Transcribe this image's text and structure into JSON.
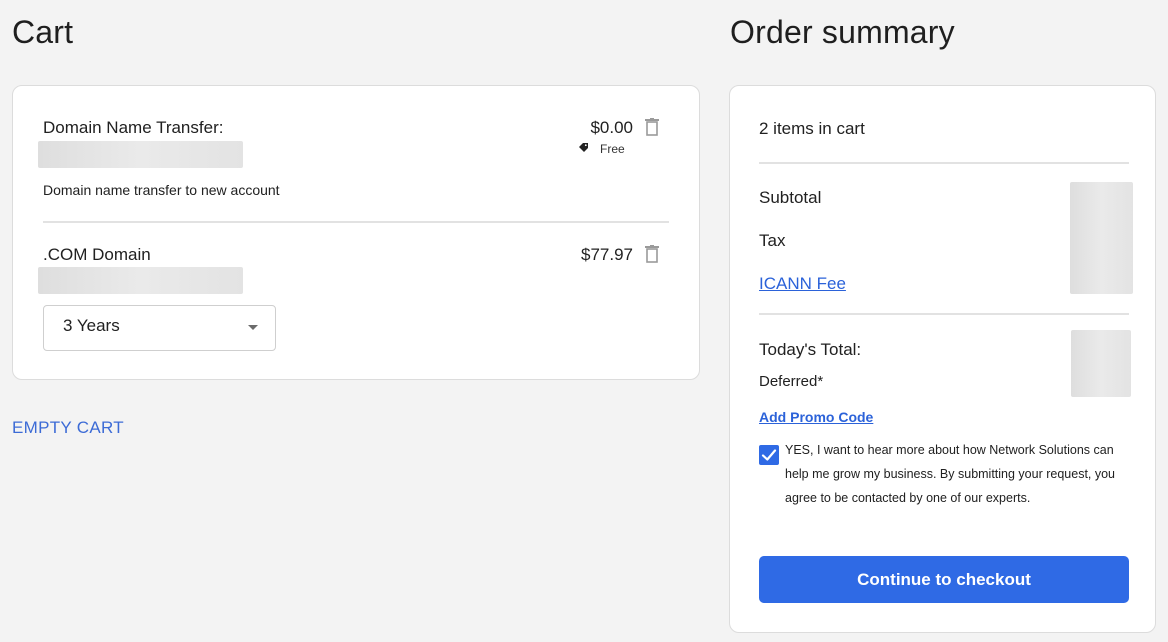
{
  "cart": {
    "title": "Cart",
    "items": [
      {
        "name": "Domain Name Transfer:",
        "price": "$0.00",
        "badge_icon": "tag-icon",
        "badge": "Free",
        "description": "Domain name transfer to new account"
      },
      {
        "name": ".COM Domain",
        "price": "$77.97",
        "term_selected": "3 Years"
      }
    ],
    "empty_cart_label": "EMPTY CART"
  },
  "summary": {
    "title": "Order summary",
    "items_count": "2 items in cart",
    "subtotal_label": "Subtotal",
    "tax_label": "Tax",
    "icann_label": "ICANN Fee",
    "total_label": "Today's Total:",
    "deferred_label": "Deferred*",
    "promo_label": "Add Promo Code",
    "consent_checked": true,
    "consent_text": "YES, I want to hear more about how Network Solutions can help me grow my business. By submitting your request, you agree to be contacted by one of our experts.",
    "checkout_label": "Continue to checkout"
  },
  "colors": {
    "accent": "#2f6ae5",
    "link": "#2b62d9",
    "background": "#f3f3f3"
  }
}
